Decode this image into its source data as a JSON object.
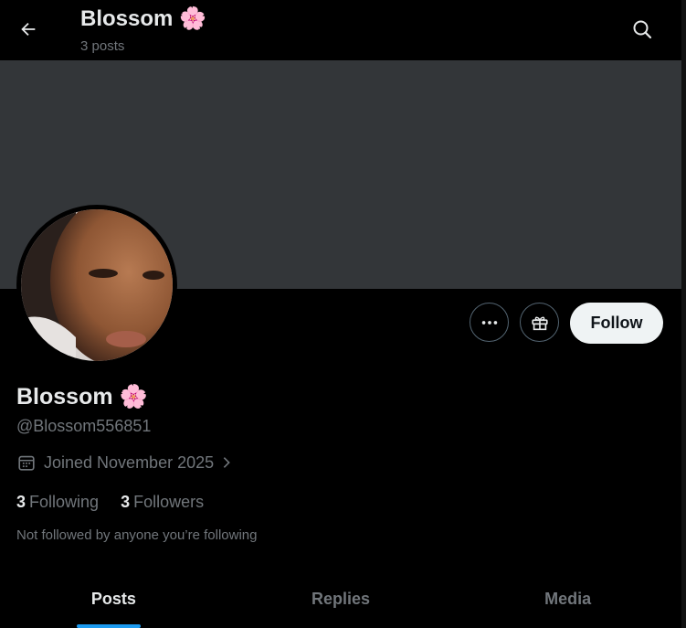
{
  "header": {
    "title": "Blossom 🌸",
    "subtitle": "3 posts"
  },
  "profile": {
    "name": "Blossom 🌸",
    "handle": "@Blossom556851",
    "joined": "Joined November 2025",
    "following_count": "3",
    "following_label": "Following",
    "followers_count": "3",
    "followers_label": "Followers",
    "not_followed": "Not followed by anyone you’re following"
  },
  "actions": {
    "follow_label": "Follow"
  },
  "tabs": [
    {
      "label": "Posts",
      "active": true
    },
    {
      "label": "Replies",
      "active": false
    },
    {
      "label": "Media",
      "active": false
    }
  ],
  "colors": {
    "background": "#000000",
    "banner": "#333639",
    "accent": "#1d9bf0",
    "muted_text": "#71767b",
    "follow_button_bg": "#eff3f4"
  },
  "icons": [
    "back-arrow-icon",
    "search-icon",
    "more-icon",
    "gift-icon",
    "calendar-icon",
    "chevron-right-icon"
  ]
}
